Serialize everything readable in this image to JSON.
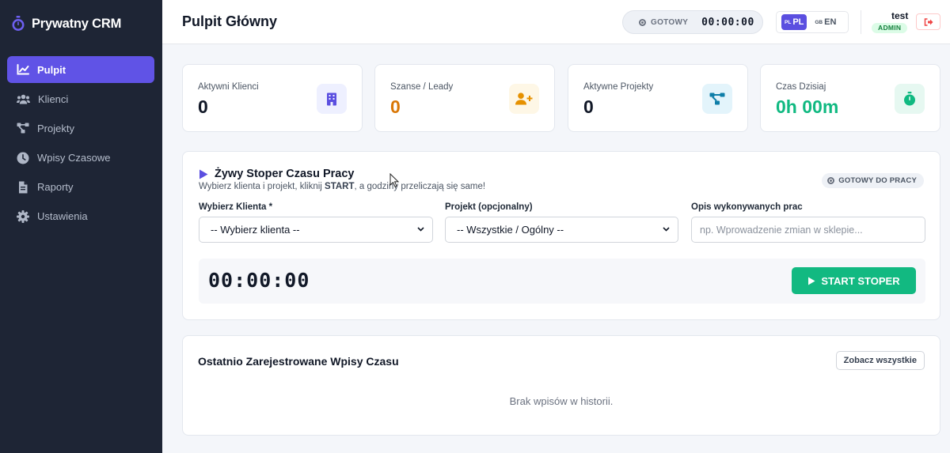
{
  "app": {
    "name": "Prywatny CRM"
  },
  "sidebar": {
    "items": [
      {
        "label": "Pulpit",
        "icon": "chart-line-icon",
        "active": true
      },
      {
        "label": "Klienci",
        "icon": "users-icon"
      },
      {
        "label": "Projekty",
        "icon": "project-diagram-icon"
      },
      {
        "label": "Wpisy Czasowe",
        "icon": "clock-icon"
      },
      {
        "label": "Raporty",
        "icon": "file-report-icon"
      },
      {
        "label": "Ustawienia",
        "icon": "gear-icon"
      }
    ]
  },
  "header": {
    "title": "Pulpit Główny",
    "timer": {
      "status": "GOTOWY",
      "time": "00:00:00"
    },
    "languages": [
      {
        "flag": "PL",
        "code": "PL",
        "active": true
      },
      {
        "flag": "GB",
        "code": "EN",
        "active": false
      }
    ],
    "user": {
      "name": "test",
      "role": "ADMIN"
    }
  },
  "stats": [
    {
      "label": "Aktywni Klienci",
      "value": "0",
      "color": "#111827",
      "icon": "building-icon",
      "icon_color": "#5b4fe0",
      "icon_bg": "#eef0ff"
    },
    {
      "label": "Szanse / Leady",
      "value": "0",
      "color": "#d97706",
      "icon": "user-plus-icon",
      "icon_color": "#e69100",
      "icon_bg": "#fef7e6"
    },
    {
      "label": "Aktywne Projekty",
      "value": "0",
      "color": "#111827",
      "icon": "project-diagram-icon",
      "icon_color": "#0e7ea8",
      "icon_bg": "#e3f4fb"
    },
    {
      "label": "Czas Dzisiaj",
      "value": "0h 00m",
      "color": "#10b981",
      "icon": "stopwatch-icon",
      "icon_color": "#10b981",
      "icon_bg": "#e6f8f1"
    }
  ],
  "stopwatch": {
    "title": "Żywy Stoper Czasu Pracy",
    "subtitle_pre": "Wybierz klienta i projekt, kliknij ",
    "subtitle_bold": "START",
    "subtitle_post": ", a godziny przeliczają się same!",
    "badge": "GOTOWY DO PRACY",
    "client_label": "Wybierz Klienta *",
    "client_value": "-- Wybierz klienta --",
    "project_label": "Projekt (opcjonalny)",
    "project_value": "-- Wszystkie / Ogólny --",
    "desc_label": "Opis wykonywanych prac",
    "desc_placeholder": "np. Wprowadzenie zmian w sklepie...",
    "display": "00:00:00",
    "start_label": "START STOPER",
    "colors": {
      "accent": "#5b4fe0",
      "start": "#12b981"
    }
  },
  "recent": {
    "title": "Ostatnio Zarejestrowane Wpisy Czasu",
    "see_all": "Zobacz wszystkie",
    "empty": "Brak wpisów w historii."
  }
}
